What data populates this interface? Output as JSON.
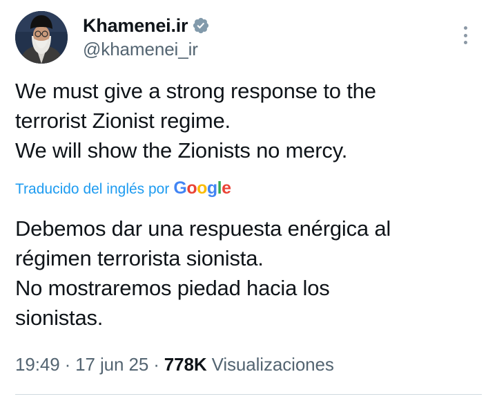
{
  "author": {
    "display_name": "Khamenei.ir",
    "handle": "@khamenei_ir",
    "verified": true
  },
  "tweet": {
    "original_text": "We must give a strong response to the\nterrorist Zionist regime.\nWe will show the Zionists no mercy.",
    "translation": {
      "label": "Traducido del inglés por",
      "provider": "Google",
      "provider_colors": [
        "#4285F4",
        "#EA4335",
        "#FBBC05",
        "#4285F4",
        "#34A853",
        "#EA4335"
      ]
    },
    "translated_text": "Debemos dar una respuesta enérgica al\nrégimen terrorista sionista.\nNo mostraremos piedad hacia los\nsionistas."
  },
  "meta": {
    "time": "19:49",
    "separator": "·",
    "date": "17 jun 25",
    "views_count": "778K",
    "views_label": "Visualizaciones"
  },
  "icons": {
    "verified": "verified-badge-icon",
    "more": "more-options-icon"
  },
  "colors": {
    "link": "#1d9bf0",
    "secondary_text": "#536471",
    "primary_text": "#0f1419",
    "verified_badge": "#829aab"
  }
}
